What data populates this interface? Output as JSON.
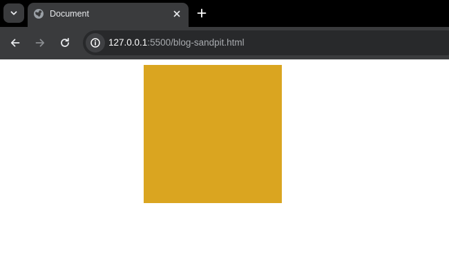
{
  "tab": {
    "title": "Document",
    "favicon_icon": "globe-icon",
    "close_icon": "close-icon"
  },
  "tabstrip": {
    "tab_search_icon": "chevron-down-icon",
    "new_tab_icon": "plus-icon"
  },
  "toolbar": {
    "back_icon": "arrow-left-icon",
    "forward_icon": "arrow-right-icon",
    "reload_icon": "reload-icon",
    "site_info_icon": "info-icon"
  },
  "address_bar": {
    "host": "127.0.0.1",
    "rest": ":5500/blog-sandpit.html"
  },
  "page": {
    "square_color": "#DAA520"
  },
  "colors": {
    "tabstrip_bg": "#000000",
    "toolbar_bg": "#3a3b3d",
    "omnibox_bg": "#28292b",
    "page_bg": "#ffffff"
  }
}
